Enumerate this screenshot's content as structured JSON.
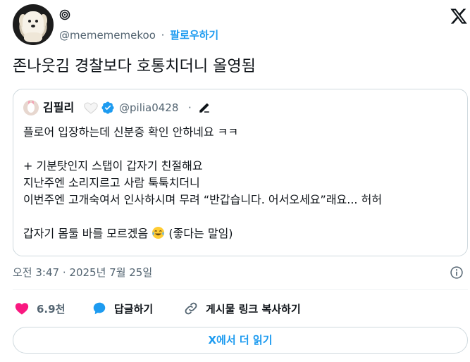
{
  "author": {
    "handle": "@memememekoo",
    "separator": "·",
    "follow_label": "팔로우하기",
    "name_icon": "spiral-icon"
  },
  "tweet": {
    "text": "존나웃김 경찰보다 호통치더니 올영됨"
  },
  "quote": {
    "name": "김필리",
    "name_emoji": "white-heart-icon",
    "verified": "verified-badge-icon",
    "handle": "@pilia0428",
    "separator": "·",
    "lines": [
      "플로어 입장하는데 신분증 확인 안하네요 ㅋㅋ",
      "",
      "+ 기분탓인지 스탭이 갑자기 친절해요",
      "지난주엔 소리지르고 사람 툭툭치더니",
      "이번주엔 고개숙여서 인사하시며 무려 “반갑습니다. 어서오세요”래요... 허허",
      "",
      "갑자기 몸둘 바를 모르겠음",
      "(좋다는 말임)"
    ]
  },
  "meta": {
    "time": "오전 3:47",
    "separator": "·",
    "date": "2025년 7월 25일"
  },
  "actions": {
    "like_count": "6.9천",
    "reply_label": "답글하기",
    "copy_link_label": "게시물 링크 복사하기"
  },
  "read_more_label": "X에서 더 읽기",
  "colors": {
    "accent": "#1d9bf0",
    "like": "#f91880",
    "text": "#0f1419",
    "muted": "#536471",
    "border": "#cfd9de"
  }
}
